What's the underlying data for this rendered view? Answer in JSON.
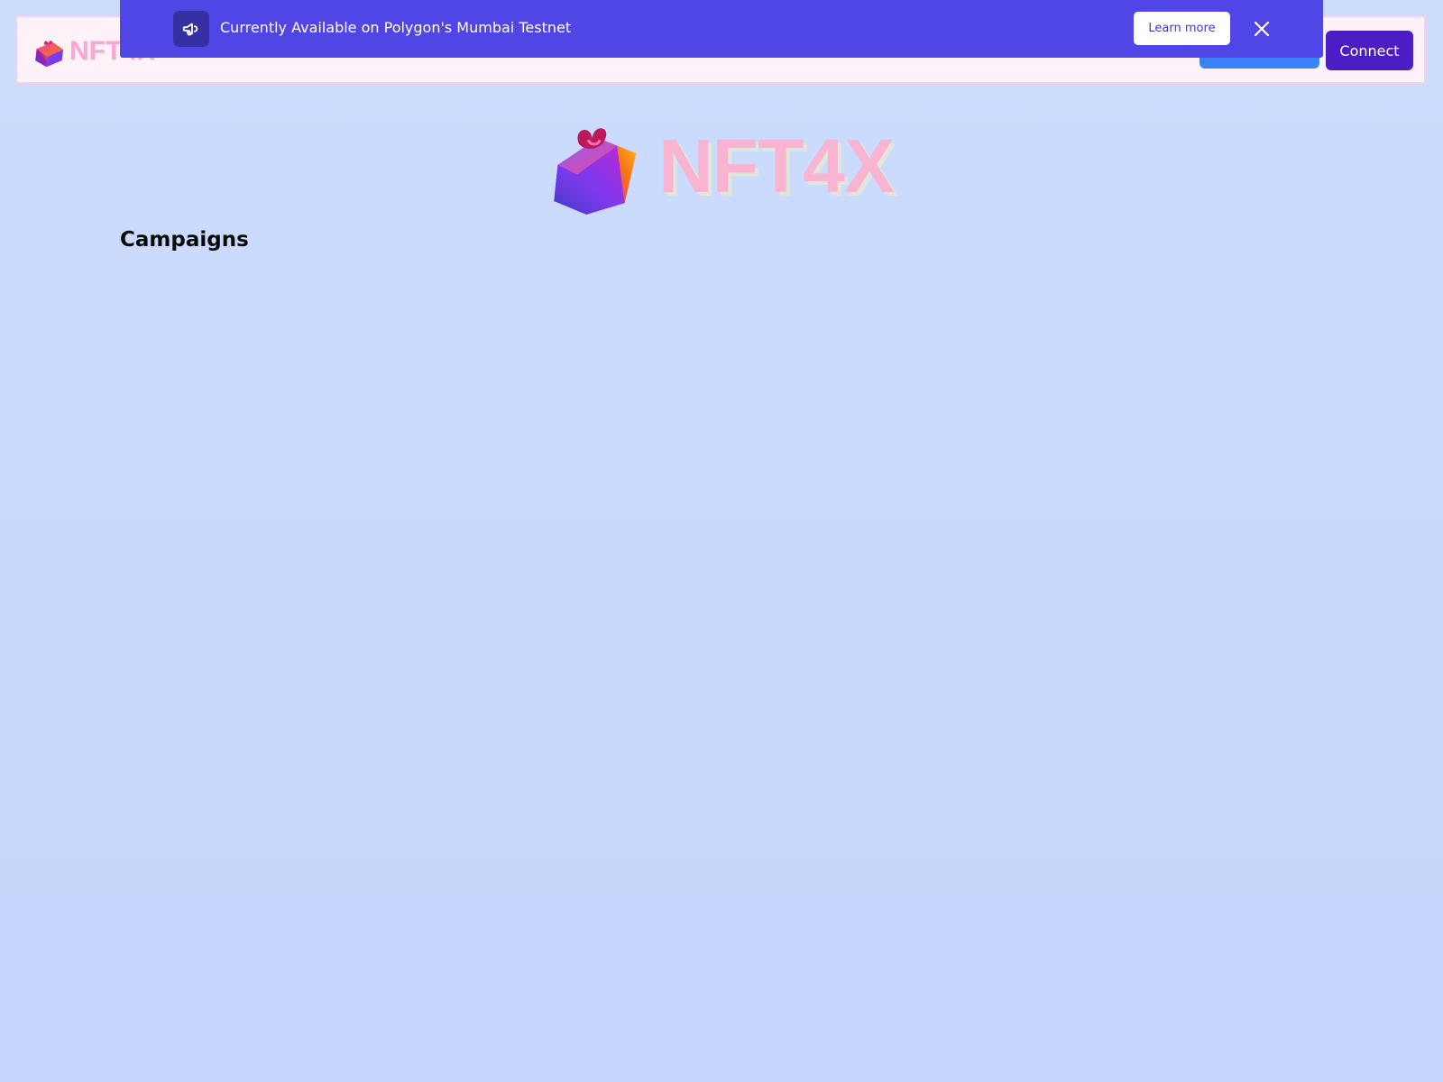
{
  "banner": {
    "icon": "megaphone-icon",
    "text": "Currently Available on Polygon's Mumbai Testnet",
    "learn_more_label": "Learn more",
    "close_icon": "close-icon",
    "background": "#4f46e5"
  },
  "navbar": {
    "brand_text": "NFT4X",
    "brand_icon": "gift-box-icon",
    "connect_label": "Connect",
    "accent_blue": "#3b82f6",
    "accent_purple": "#4c1dc4"
  },
  "hero": {
    "logo_text": "NFT4X",
    "logo_icon": "gift-box-icon"
  },
  "main": {
    "section_title": "Campaigns"
  }
}
